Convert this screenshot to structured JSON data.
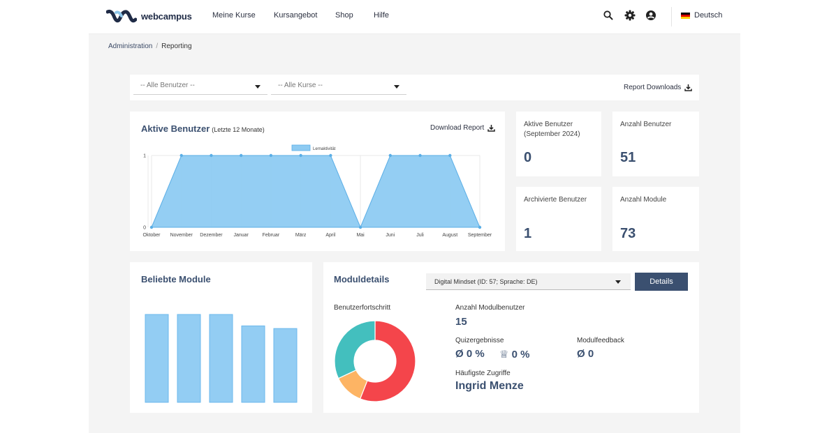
{
  "header": {
    "brand": "webcampus",
    "nav": [
      "Meine Kurse",
      "Kursangebot",
      "Shop",
      "Hilfe"
    ],
    "language": "Deutsch",
    "icons": [
      "search-icon",
      "gear-icon",
      "account-icon",
      "flag-de-icon"
    ]
  },
  "breadcrumb": {
    "parent": "Administration",
    "separator": "/",
    "current": "Reporting"
  },
  "filters": {
    "users_placeholder": "-- Alle Benutzer --",
    "courses_placeholder": "-- Alle Kurse --",
    "report_downloads": "Report Downloads"
  },
  "active_users": {
    "title": "Aktive Benutzer",
    "subtitle": "(Letzte 12 Monate)",
    "download": "Download Report"
  },
  "stats": {
    "active": {
      "label": "Aktive Benutzer (September 2024)",
      "value": "0"
    },
    "users": {
      "label": "Anzahl Benutzer",
      "value": "51"
    },
    "archived": {
      "label": "Archivierte Benutzer",
      "value": "1"
    },
    "modules": {
      "label": "Anzahl Module",
      "value": "73"
    }
  },
  "popular_modules": {
    "title": "Beliebte Module"
  },
  "module_details": {
    "title": "Moduldetails",
    "selected_module": "Digital Mindset (ID: 57; Sprache: DE)",
    "details_button": "Details",
    "progress_label": "Benutzerfortschritt",
    "module_users_label": "Anzahl Modulbenutzer",
    "module_users_value": "15",
    "quiz_label": "Quizergebnisse",
    "quiz_avg": "Ø 0 %",
    "quiz_best": "♕ 0 %",
    "feedback_label": "Modulfeedback",
    "feedback_value": "Ø 0",
    "frequent_label": "Häufigste Zugriffe",
    "frequent_value": "Ingrid Menze"
  },
  "chart_data": [
    {
      "type": "area",
      "legend": [
        "Lernaktivität"
      ],
      "categories": [
        "Oktober",
        "November",
        "Dezember",
        "Januar",
        "Februar",
        "März",
        "April",
        "Mai",
        "Juni",
        "Juli",
        "August",
        "September"
      ],
      "series": [
        {
          "name": "Lernaktivität",
          "values": [
            0,
            1,
            1,
            1,
            1,
            1,
            1,
            0,
            1,
            1,
            1,
            0
          ]
        }
      ],
      "ylim": [
        0,
        1
      ],
      "yticks": [
        "0",
        "1"
      ],
      "grid": true,
      "color": "#8ecbf2"
    },
    {
      "type": "bar",
      "values": [
        1,
        1,
        1,
        0.87,
        0.84
      ],
      "color": "#93cdf3"
    },
    {
      "type": "pie",
      "donut": true,
      "values": [
        56,
        12,
        32
      ],
      "colors": [
        "#f4454b",
        "#fdb464",
        "#43bfbe"
      ]
    }
  ]
}
